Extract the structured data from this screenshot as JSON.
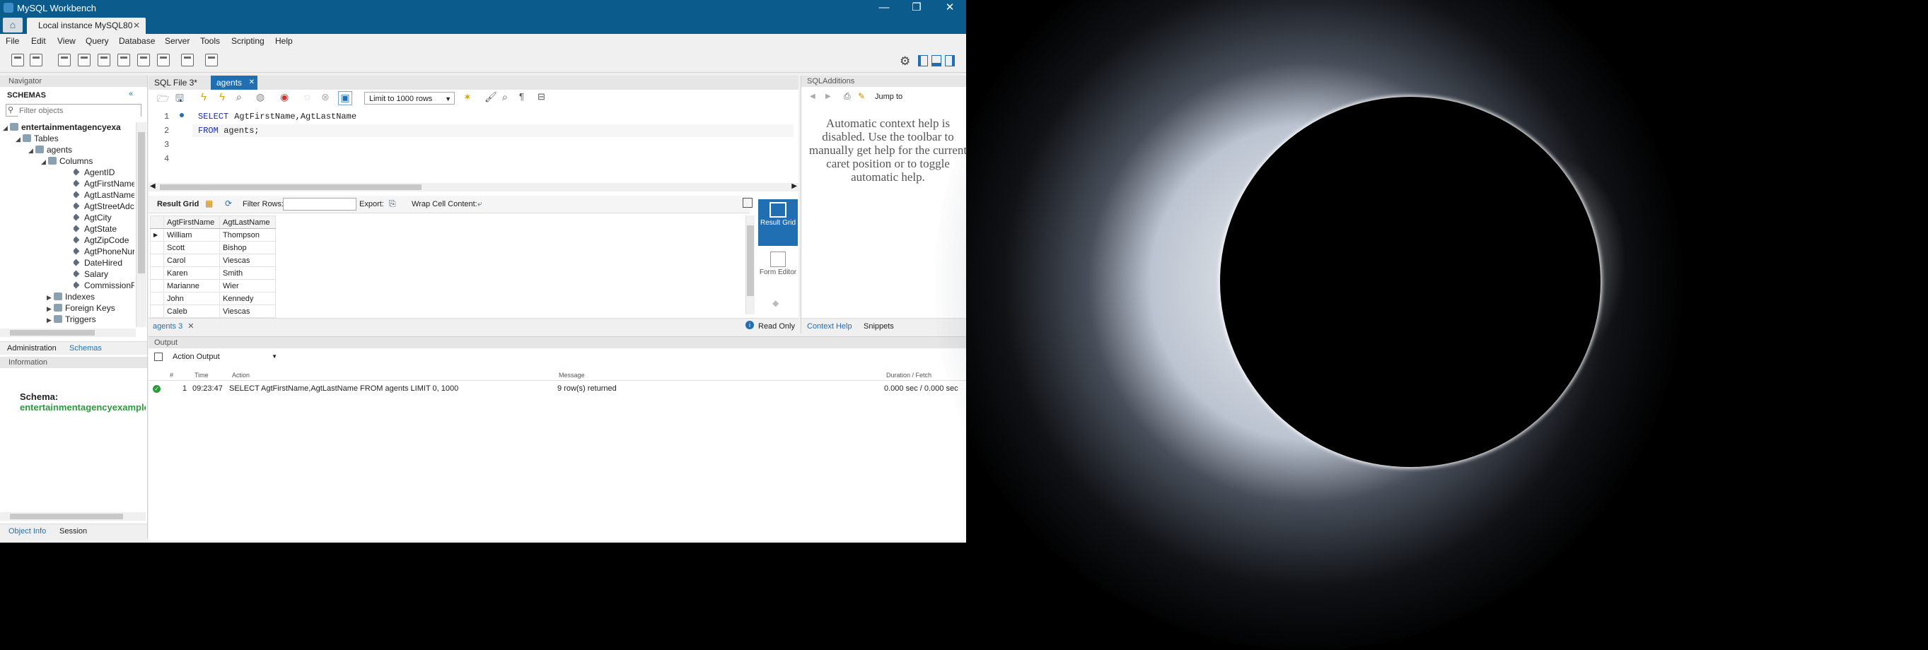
{
  "window": {
    "title": "MySQL Workbench",
    "minimize": "—",
    "maximize": "❐",
    "close": "✕"
  },
  "connection_tab": {
    "label": "Local instance MySQL80",
    "close": "✕"
  },
  "menu": [
    "File",
    "Edit",
    "View",
    "Query",
    "Database",
    "Server",
    "Tools",
    "Scripting",
    "Help"
  ],
  "navigator": {
    "header": "Navigator",
    "schemas_label": "SCHEMAS",
    "filter_placeholder": "Filter objects",
    "tree": {
      "schema": "entertainmentagencyexa",
      "tables": "Tables",
      "table": "agents",
      "columns_label": "Columns",
      "columns": [
        "AgentID",
        "AgtFirstName",
        "AgtLastName",
        "AgtStreetAdc",
        "AgtCity",
        "AgtState",
        "AgtZipCode",
        "AgtPhoneNur",
        "DateHired",
        "Salary",
        "CommissionF"
      ],
      "indexes": "Indexes",
      "foreign_keys": "Foreign Keys",
      "triggers": "Triggers"
    },
    "bottom_tabs": [
      "Administration",
      "Schemas"
    ]
  },
  "information": {
    "header": "Information",
    "schema_label": "Schema:",
    "schema_value": "entertainmentagencyexample"
  },
  "bottom_left_tabs": [
    "Object Info",
    "Session"
  ],
  "query_tabs": [
    {
      "label": "SQL File 3*"
    },
    {
      "label": "agents",
      "close": "✕"
    }
  ],
  "editor": {
    "limit": "Limit to 1000 rows",
    "lines": [
      {
        "num": "1",
        "kw": "SELECT",
        "rest": " AgtFirstName,AgtLastName"
      },
      {
        "num": "2",
        "kw": "FROM",
        "rest": " agents;"
      },
      {
        "num": "3",
        "kw": "",
        "rest": ""
      },
      {
        "num": "4",
        "kw": "",
        "rest": ""
      }
    ]
  },
  "result_toolbar": {
    "result_grid": "Result Grid",
    "filter_rows": "Filter Rows:",
    "export": "Export:",
    "wrap": "Wrap Cell Content:"
  },
  "result_grid": {
    "headers": [
      "AgtFirstName",
      "AgtLastName"
    ],
    "rows": [
      [
        "William",
        "Thompson"
      ],
      [
        "Scott",
        "Bishop"
      ],
      [
        "Carol",
        "Viescas"
      ],
      [
        "Karen",
        "Smith"
      ],
      [
        "Marianne",
        "Wier"
      ],
      [
        "John",
        "Kennedy"
      ],
      [
        "Caleb",
        "Viescas"
      ]
    ]
  },
  "side_views": {
    "result_grid": "Result Grid",
    "form_editor": "Form Editor"
  },
  "result_tab": {
    "label": "agents 3",
    "close": "✕",
    "read_only": "Read Only"
  },
  "sql_additions": {
    "header": "SQLAdditions",
    "jump_to": "Jump to",
    "context_help": "Automatic context help is disabled. Use the toolbar to manually get help for the current caret position or to toggle automatic help.",
    "tabs": [
      "Context Help",
      "Snippets"
    ]
  },
  "output": {
    "header": "Output",
    "selector": "Action Output",
    "columns": [
      "#",
      "Time",
      "Action",
      "Message",
      "Duration / Fetch"
    ],
    "rows": [
      {
        "num": "1",
        "time": "09:23:47",
        "action": "SELECT AgtFirstName,AgtLastName FROM agents LIMIT 0, 1000",
        "message": "9 row(s) returned",
        "duration": "0.000 sec / 0.000 sec"
      }
    ]
  },
  "colors": {
    "titlebar": "#0b5b8d",
    "accent": "#1f6fb2",
    "success": "#2a9a3a",
    "keyword": "#1a2cb3"
  }
}
